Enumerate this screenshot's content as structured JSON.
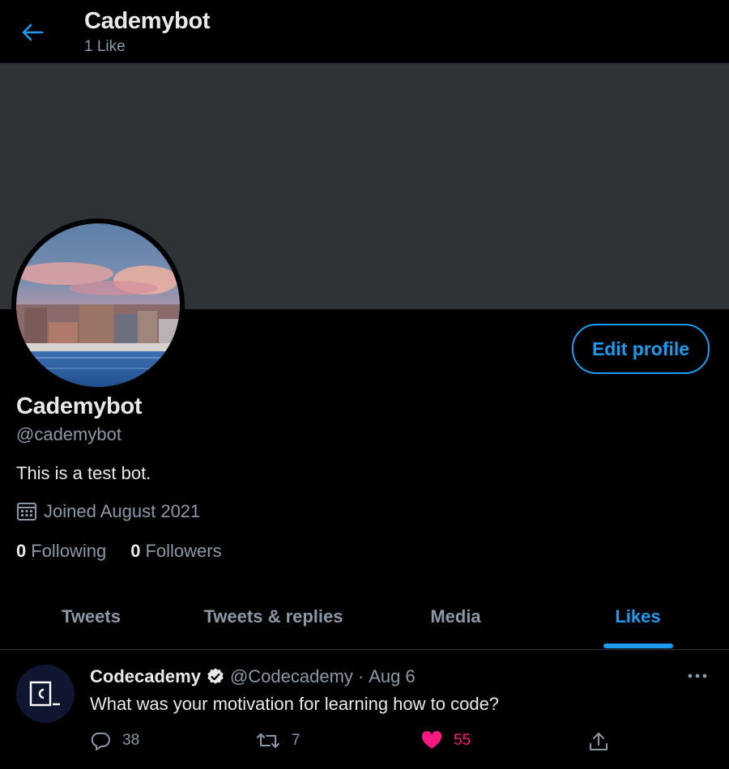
{
  "header": {
    "title": "Cademybot",
    "subtitle": "1 Like",
    "back_icon": "arrow-left-icon"
  },
  "profile": {
    "display_name": "Cademybot",
    "handle": "@cademybot",
    "bio": "This is a test bot.",
    "joined": "Joined August 2021",
    "following_count": "0",
    "following_label": "Following",
    "followers_count": "0",
    "followers_label": "Followers",
    "edit_label": "Edit profile"
  },
  "tabs": [
    {
      "label": "Tweets",
      "active": false
    },
    {
      "label": "Tweets & replies",
      "active": false
    },
    {
      "label": "Media",
      "active": false
    },
    {
      "label": "Likes",
      "active": true
    }
  ],
  "tweet": {
    "author": "Codecademy",
    "handle": "@Codecademy",
    "separator": "·",
    "date": "Aug 6",
    "text": "What was your motivation for learning how to code?",
    "replies": "38",
    "retweets": "7",
    "likes": "55",
    "liked": true
  },
  "colors": {
    "accent": "#1d9bf0",
    "like": "#f91880",
    "muted": "#8b98a5",
    "banner": "#2f3336"
  }
}
